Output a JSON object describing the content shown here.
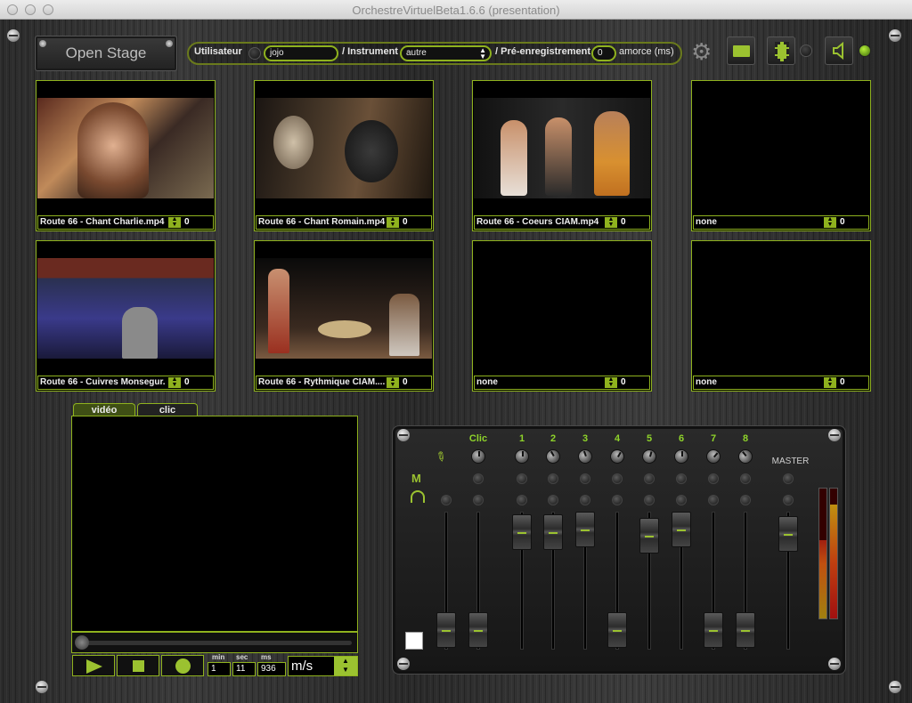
{
  "window": {
    "title": "OrchestreVirtuelBeta1.6.6 (presentation)"
  },
  "toolbar": {
    "open_stage": "Open Stage",
    "user_label": "Utilisateur",
    "user_value": "jojo",
    "instrument_label": "/ Instrument",
    "instrument_value": "autre",
    "prerec_label": "/ Pré-enregistrement",
    "prerec_value": "0",
    "amorce_label": "amorce (ms)"
  },
  "videos": [
    {
      "label": "Route 66 - Chant Charlie.mp4",
      "value": "0"
    },
    {
      "label": "Route 66 - Chant Romain.mp4",
      "value": "0"
    },
    {
      "label": "Route 66 - Coeurs CIAM.mp4",
      "value": "0"
    },
    {
      "label": "none",
      "value": "0"
    },
    {
      "label": "Route 66 - Cuivres Monsegur.",
      "value": "0"
    },
    {
      "label": "Route 66 - Rythmique CIAM....",
      "value": "0"
    },
    {
      "label": "none",
      "value": "0"
    },
    {
      "label": "none",
      "value": "0"
    }
  ],
  "tabs": {
    "video": "vidéo",
    "click": "clic"
  },
  "transport": {
    "min_label": "min",
    "sec_label": "sec",
    "ms_label": "ms",
    "min": "1",
    "sec": "11",
    "ms": "936",
    "unit": "m/s"
  },
  "mixer": {
    "channels": [
      "Clic",
      "1",
      "2",
      "3",
      "4",
      "5",
      "6",
      "7",
      "8"
    ],
    "master_label": "MASTER",
    "m_label": "M"
  }
}
